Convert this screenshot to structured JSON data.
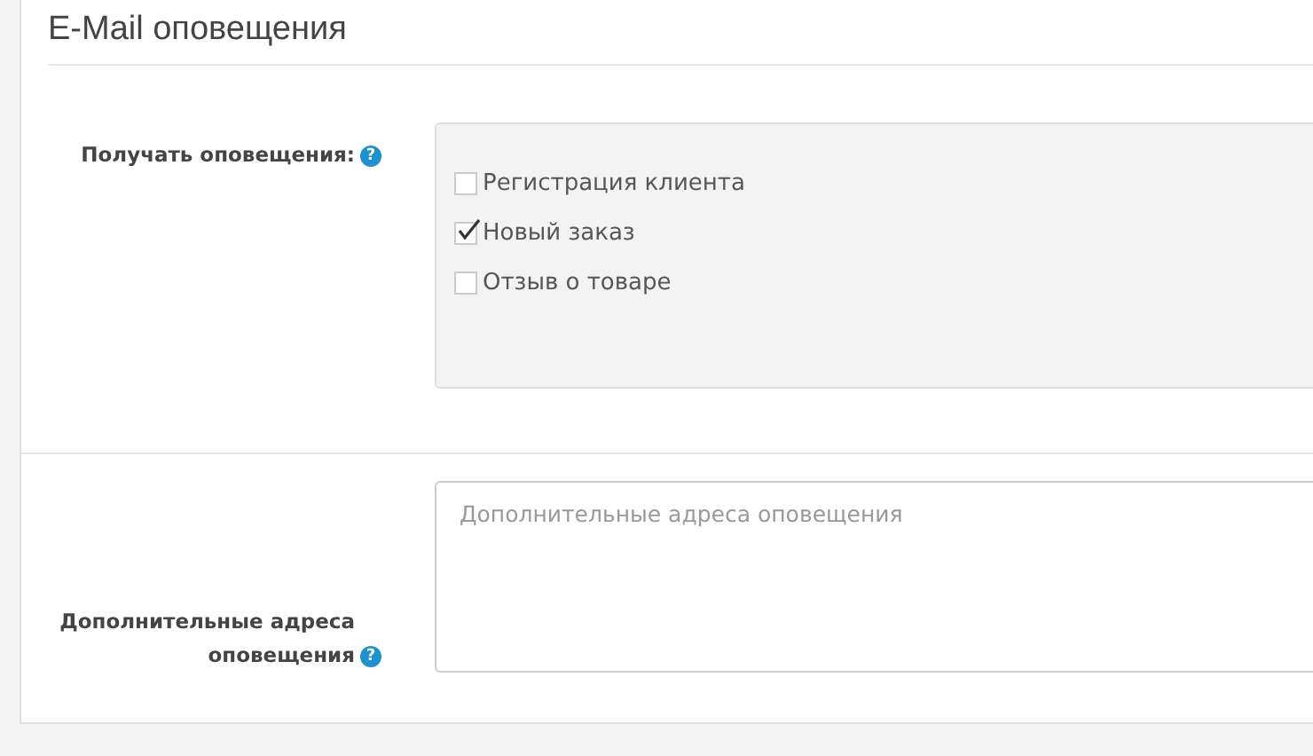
{
  "panel": {
    "title": "E-Mail оповещения"
  },
  "notifications": {
    "label": "Получать оповещения:",
    "help": "?",
    "options": [
      {
        "label": "Регистрация клиента",
        "checked": false
      },
      {
        "label": "Новый заказ",
        "checked": true
      },
      {
        "label": "Отзыв о товаре",
        "checked": false
      }
    ]
  },
  "extra_addresses": {
    "label": "Дополнительные адреса оповещения",
    "help": "?",
    "placeholder": "Дополнительные адреса оповещения"
  }
}
